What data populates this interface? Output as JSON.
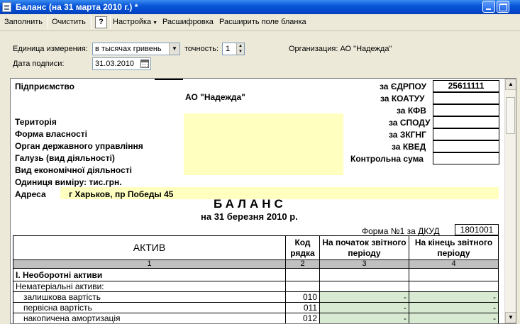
{
  "window": {
    "title": "Баланс (на 31 марта 2010 г.) *"
  },
  "toolbar": {
    "fill": "Заполнить",
    "clear": "Очистить",
    "help": "?",
    "settings": "Настройка",
    "decode": "Расшифровка",
    "expand": "Расширить поле бланка"
  },
  "params": {
    "unit_label": "Единица измерения:",
    "unit_value": "в тысячах гривень",
    "precision_label": "точность:",
    "precision_value": "1",
    "org_label": "Организация: АО \"Надежда\"",
    "date_label": "Дата подписи:",
    "date_value": "31.03.2010"
  },
  "form": {
    "enterprise_label": "Підприємство",
    "enterprise_value": "АО \"Надежда\"",
    "territory": "Територія",
    "ownership": "Форма власності",
    "authority": "Орган державного управління",
    "branch": "Галузь (вид діяльності)",
    "activity": "Вид економічної діяльності",
    "unit": "Одиниця виміру: тис.грн.",
    "address_label": "Адреса",
    "address_value": "г Харьков, пр Победы 45",
    "codes": [
      {
        "label": "за ЄДРПОУ",
        "value": "25611111"
      },
      {
        "label": "за КОАТУУ",
        "value": ""
      },
      {
        "label": "за КФВ",
        "value": ""
      },
      {
        "label": "за СПОДУ",
        "value": ""
      },
      {
        "label": "за ЗКГНГ",
        "value": ""
      },
      {
        "label": "за КВЕД",
        "value": ""
      },
      {
        "label": "Контрольна сума",
        "value": ""
      }
    ],
    "title": "БАЛАНС",
    "subtitle": "на 31 березня 2010 р.",
    "dkud_label": "Форма №1 за ДКУД",
    "dkud_value": "1801001"
  },
  "table": {
    "headers": {
      "active": "АКТИВ",
      "code": "Код рядка",
      "start": "На початок звітного періоду",
      "end": "На кінець звітного періоду"
    },
    "col_numbers": [
      "1",
      "2",
      "3",
      "4"
    ],
    "section": "І. Необоротні активи",
    "group": "Нематеріальні активи:",
    "rows": [
      {
        "name": "залишкова вартість",
        "code": "010",
        "start": "-",
        "end": "-"
      },
      {
        "name": "первісна вартість",
        "code": "011",
        "start": "-",
        "end": "-"
      },
      {
        "name": "накопичена амортизація",
        "code": "012",
        "start": "-",
        "end": "-"
      }
    ]
  }
}
